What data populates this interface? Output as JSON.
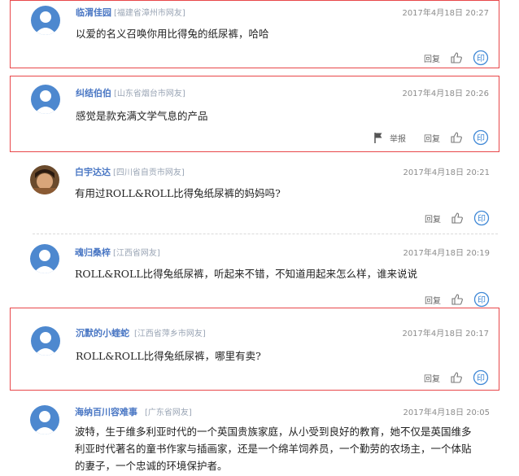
{
  "comments": [
    {
      "user": "临渭佳园",
      "location": "[福建省漳州市网友]",
      "time": "2017年4月18日 20:27",
      "text": "以爱的名义召唤你用比得兔的纸尿裤，哈哈",
      "reply": "回复",
      "report": ""
    },
    {
      "user": "纠结伯伯",
      "location": "[山东省烟台市网友]",
      "time": "2017年4月18日 20:26",
      "text": "感觉是款充满文学气息的产品",
      "reply": "回复",
      "report": "举报"
    },
    {
      "user": "白宇达达",
      "location": "[四川省自贡市网友]",
      "time": "2017年4月18日 20:21",
      "text": "有用过ROLL&ROLL比得兔纸尿裤的妈妈吗?",
      "reply": "回复",
      "report": ""
    },
    {
      "user": "魂归桑梓",
      "location": "[江西省网友]",
      "time": "2017年4月18日 20:19",
      "text": "ROLL&ROLL比得兔纸尿裤，听起来不错，不知道用起来怎么样，谁来说说",
      "reply": "回复",
      "report": ""
    },
    {
      "user": "沉默的小蝰蛇",
      "location": "[江西省萍乡市网友]",
      "time": "2017年4月18日 20:17",
      "text": "ROLL&ROLL比得兔纸尿裤，哪里有卖?",
      "reply": "回复",
      "report": ""
    },
    {
      "user": "海纳百川容难事",
      "location": "[广东省网友]",
      "time": "2017年4月18日 20:05",
      "text": "波特，生于维多利亚时代的一个英国贵族家庭，从小受到良好的教育，她不仅是英国维多利亚时代著名的童书作家与插画家，还是一个绵羊饲养员，一个勤劳的农场主，一个体贴的妻子，一个忠诚的环境保护者。",
      "reply": "",
      "report": ""
    }
  ],
  "share_icon_glyph": "印",
  "colors": {
    "highlight": "#e8474a",
    "username": "#4a77c4",
    "location": "#9aa5b5",
    "share": "#3f88d6"
  },
  "icons": [
    "avatar-default-icon",
    "avatar-photo-icon",
    "thumbs-up-icon",
    "share-icon",
    "flag-icon"
  ]
}
